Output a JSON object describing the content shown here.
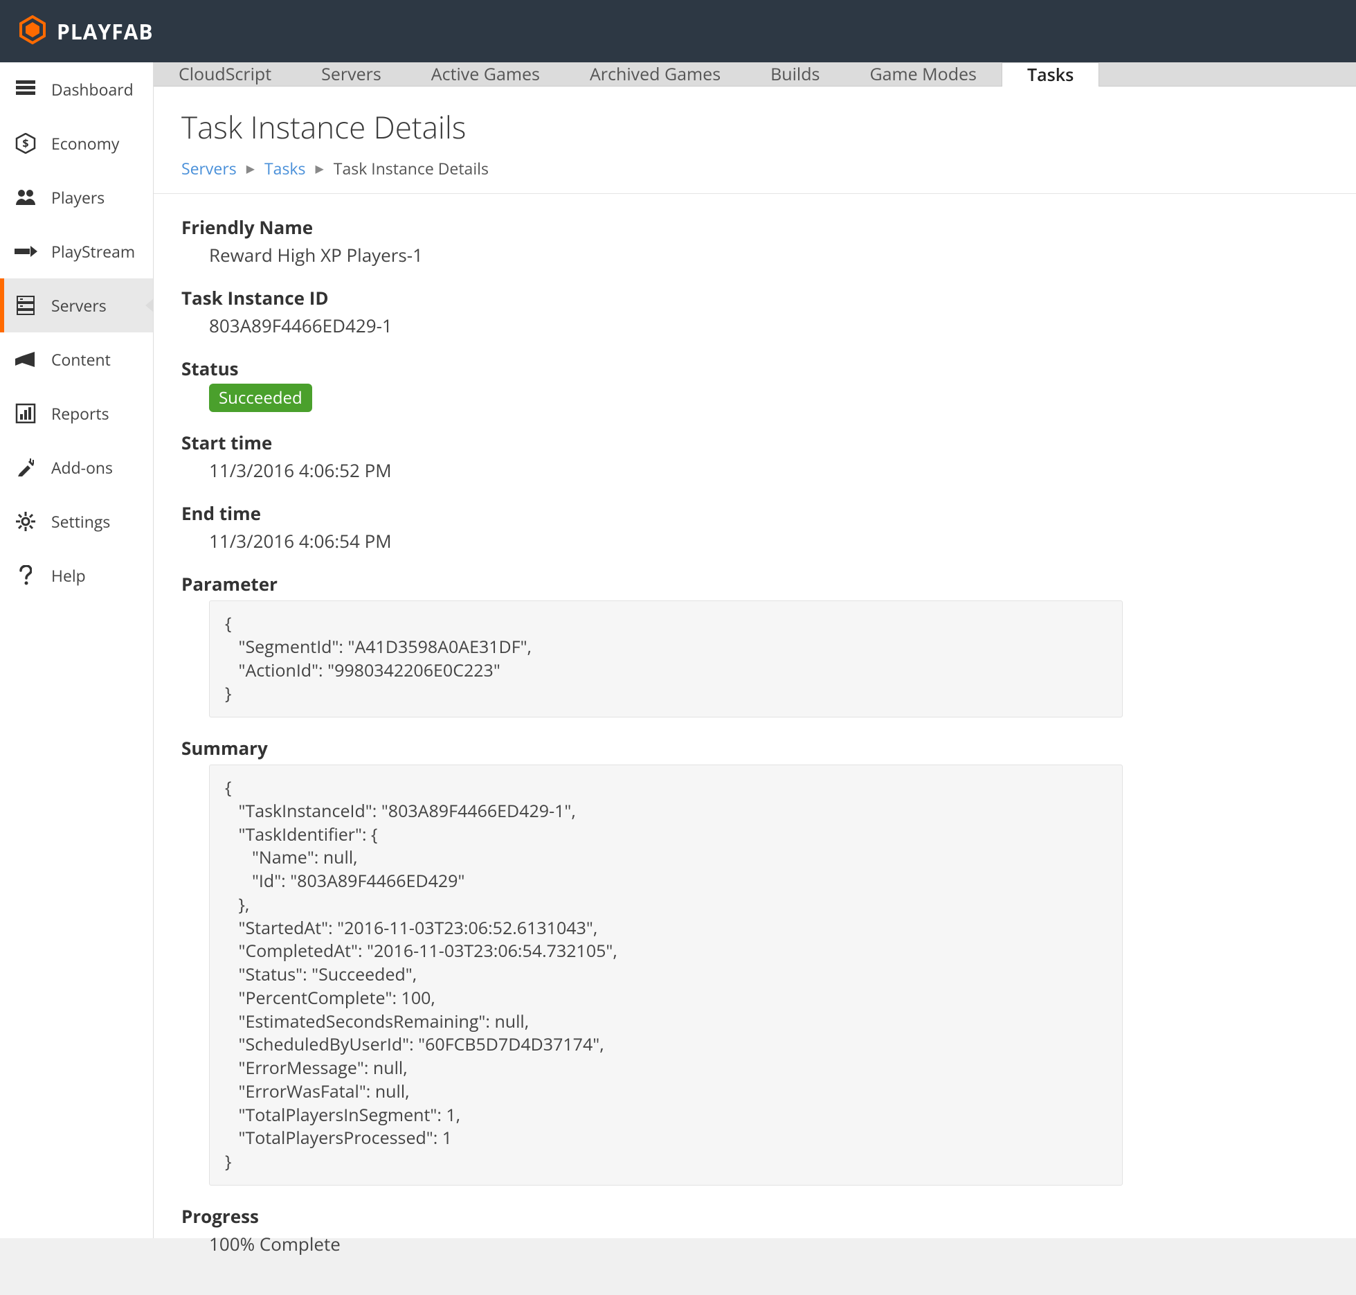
{
  "brand": "PLAYFAB",
  "sidebar": {
    "items": [
      {
        "label": "Dashboard",
        "icon": "dashboard-icon",
        "active": false
      },
      {
        "label": "Economy",
        "icon": "economy-icon",
        "active": false
      },
      {
        "label": "Players",
        "icon": "players-icon",
        "active": false
      },
      {
        "label": "PlayStream",
        "icon": "playstream-icon",
        "active": false
      },
      {
        "label": "Servers",
        "icon": "servers-icon",
        "active": true
      },
      {
        "label": "Content",
        "icon": "content-icon",
        "active": false
      },
      {
        "label": "Reports",
        "icon": "reports-icon",
        "active": false
      },
      {
        "label": "Add-ons",
        "icon": "addons-icon",
        "active": false
      },
      {
        "label": "Settings",
        "icon": "settings-icon",
        "active": false
      },
      {
        "label": "Help",
        "icon": "help-icon",
        "active": false
      }
    ]
  },
  "tabs": [
    {
      "label": "CloudScript",
      "active": false
    },
    {
      "label": "Servers",
      "active": false
    },
    {
      "label": "Active Games",
      "active": false
    },
    {
      "label": "Archived Games",
      "active": false
    },
    {
      "label": "Builds",
      "active": false
    },
    {
      "label": "Game Modes",
      "active": false
    },
    {
      "label": "Tasks",
      "active": true
    }
  ],
  "page": {
    "title": "Task Instance Details",
    "breadcrumb": {
      "root": "Servers",
      "mid": "Tasks",
      "leaf": "Task Instance Details"
    }
  },
  "details": {
    "friendly_name_label": "Friendly Name",
    "friendly_name": "Reward High XP Players-1",
    "task_instance_id_label": "Task Instance ID",
    "task_instance_id": "803A89F4466ED429-1",
    "status_label": "Status",
    "status": "Succeeded",
    "start_time_label": "Start time",
    "start_time": "11/3/2016 4:06:52 PM",
    "end_time_label": "End time",
    "end_time": "11/3/2016 4:06:54 PM",
    "parameter_label": "Parameter",
    "parameter_code": "{\n   \"SegmentId\": \"A41D3598A0AE31DF\",\n   \"ActionId\": \"9980342206E0C223\"\n}",
    "summary_label": "Summary",
    "summary_code": "{\n   \"TaskInstanceId\": \"803A89F4466ED429-1\",\n   \"TaskIdentifier\": {\n      \"Name\": null,\n      \"Id\": \"803A89F4466ED429\"\n   },\n   \"StartedAt\": \"2016-11-03T23:06:52.6131043\",\n   \"CompletedAt\": \"2016-11-03T23:06:54.732105\",\n   \"Status\": \"Succeeded\",\n   \"PercentComplete\": 100,\n   \"EstimatedSecondsRemaining\": null,\n   \"ScheduledByUserId\": \"60FCB5D7D4D37174\",\n   \"ErrorMessage\": null,\n   \"ErrorWasFatal\": null,\n   \"TotalPlayersInSegment\": 1,\n   \"TotalPlayersProcessed\": 1\n}",
    "progress_label": "Progress",
    "progress": "100% Complete"
  }
}
